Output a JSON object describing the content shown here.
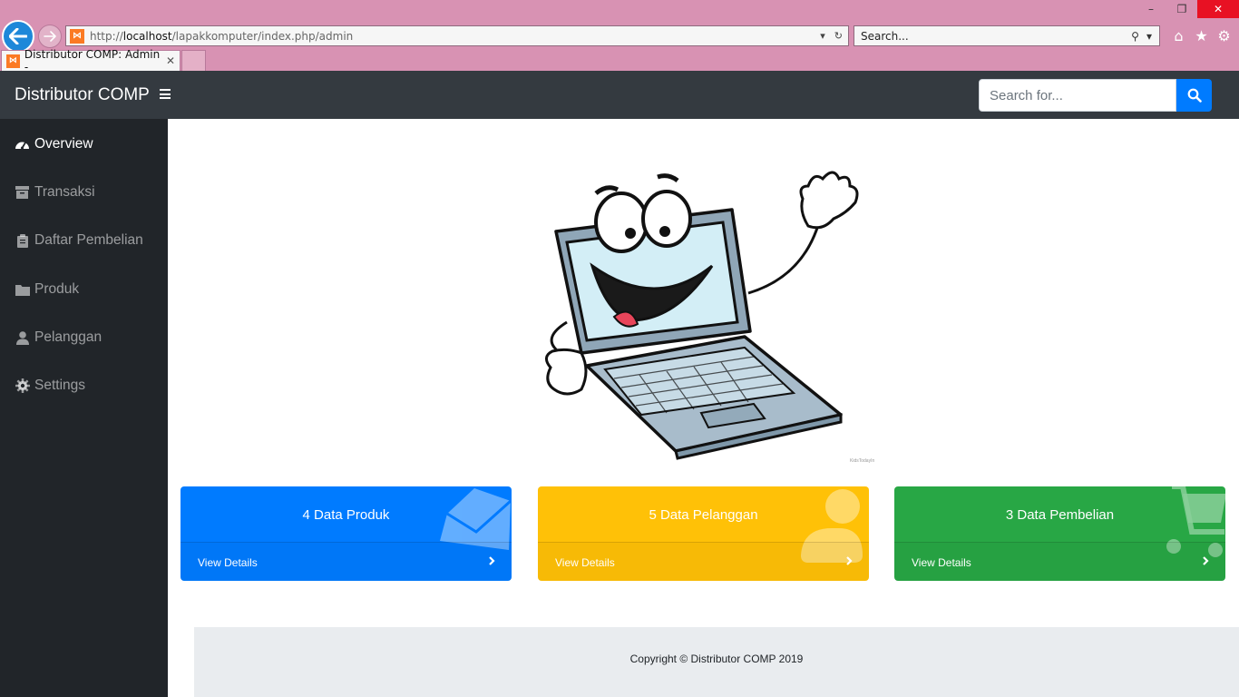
{
  "browser": {
    "url_prefix": "http://",
    "url_host": "localhost",
    "url_path": "/lapakkomputer/index.php/admin",
    "search_placeholder": "Search...",
    "tab_title": "Distributor COMP: Admin -",
    "tab_close": "✕"
  },
  "navbar": {
    "brand": "Distributor COMP",
    "search_placeholder": "Search for..."
  },
  "sidebar": {
    "items": [
      {
        "label": "Overview",
        "icon": "tachometer-icon",
        "active": true
      },
      {
        "label": "Transaksi",
        "icon": "archive-icon",
        "active": false
      },
      {
        "label": "Daftar Pembelian",
        "icon": "clipboard-icon",
        "active": false
      },
      {
        "label": "Produk",
        "icon": "folder-icon",
        "active": false
      },
      {
        "label": "Pelanggan",
        "icon": "user-icon",
        "active": false
      },
      {
        "label": "Settings",
        "icon": "gear-icon",
        "active": false
      }
    ]
  },
  "cards": [
    {
      "title": "4 Data Produk",
      "link": "View Details",
      "color": "#007bff",
      "icon": "envelope-open-icon"
    },
    {
      "title": "5 Data Pelanggan",
      "link": "View Details",
      "color": "#ffc107",
      "icon": "user-icon"
    },
    {
      "title": "3 Data Pembelian",
      "link": "View Details",
      "color": "#28a745",
      "icon": "shopping-cart-icon"
    }
  ],
  "footer": {
    "copyright": "Copyright © Distributor COMP 2019"
  },
  "colors": {
    "navbar": "#343a40",
    "sidebar": "#212529",
    "primary": "#007bff",
    "warning": "#ffc107",
    "success": "#28a745",
    "chrome": "#d892b3"
  }
}
